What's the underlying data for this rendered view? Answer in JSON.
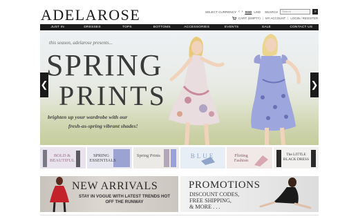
{
  "brand": {
    "logo": "ADELAROSE"
  },
  "topbar": {
    "currency_label": "SELECT CURRENCY",
    "prev_arrow": "‹",
    "next_arrow": "›",
    "currency_selected": "SGD",
    "currency_alt": "USD",
    "search_label": "SEARCH",
    "search_placeholder": "Search",
    "search_button": "»"
  },
  "subbar": {
    "cart_label": "CART: (EMPTY)",
    "account_label": "MY ACCOUNT",
    "auth_label": "LOGIN / REGISTER",
    "separator": "|"
  },
  "nav": {
    "items": [
      "JUST IN",
      "DRESSES",
      "TOPS",
      "BOTTOMS",
      "ACCESSORIES",
      "EVENTS",
      "SALE",
      "CONTACT US"
    ]
  },
  "hero": {
    "tagline": "this season, adelarose presents...",
    "title_line1": "SPRING",
    "title_line2": "PRINTS",
    "sub_line1": "brighten up your wardrobe with our",
    "sub_line2": "fresh-as-spring vibrant shades!",
    "prev": "❮",
    "next": "❯"
  },
  "thumbs": [
    {
      "label": "BOLD & BEAUTIFUL",
      "bg": "#e9e3ee"
    },
    {
      "label": "SPRING ESSENTIALS",
      "bg": "#e6e6f0"
    },
    {
      "label": "Spring Prints",
      "bg": "#eceae6"
    },
    {
      "label": "BLUE",
      "bg": "#e8eef5"
    },
    {
      "label": "Flirting Fashion",
      "bg": "#f1e8e8"
    },
    {
      "label": "The LITTLE BLACK DRESS",
      "bg": "#f1f0ef"
    }
  ],
  "banners": {
    "new_arrivals": {
      "title": "NEW ARRIVALS",
      "subtitle_line1": "STAY IN VOGUE WITH LATEST TRENDS HOT",
      "subtitle_line2": "OFF THE RUNWAY"
    },
    "promotions": {
      "title": "PROMOTIONS",
      "line1": "DISCOUNT CODES,",
      "line2": "FREE SHIPPING,",
      "line3": "& MORE . . ."
    }
  },
  "colors": {
    "nav_bg": "#1c1c1c",
    "text_dark": "#2a2a2a"
  }
}
